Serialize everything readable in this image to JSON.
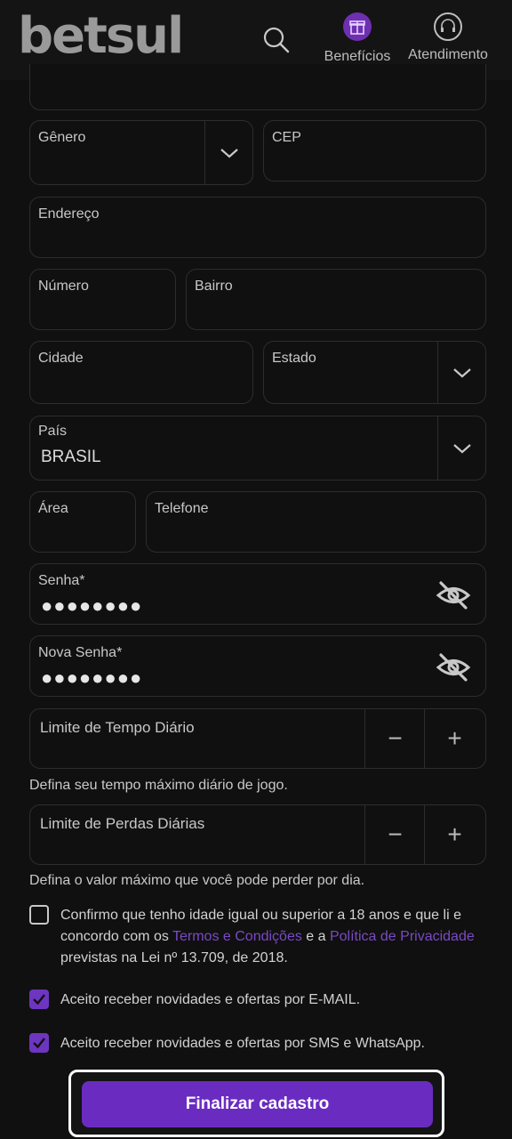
{
  "header": {
    "logo": "betsul",
    "beneficios": "Benefícios",
    "atendimento": "Atendimento"
  },
  "form": {
    "genero": {
      "label": "Gênero",
      "value": ""
    },
    "cep": {
      "label": "CEP",
      "value": ""
    },
    "endereco": {
      "label": "Endereço",
      "value": ""
    },
    "numero": {
      "label": "Número",
      "value": ""
    },
    "bairro": {
      "label": "Bairro",
      "value": ""
    },
    "cidade": {
      "label": "Cidade",
      "value": ""
    },
    "estado": {
      "label": "Estado",
      "value": ""
    },
    "pais": {
      "label": "País",
      "value": "BRASIL"
    },
    "area": {
      "label": "Área",
      "value": ""
    },
    "telefone": {
      "label": "Telefone",
      "value": ""
    },
    "senha": {
      "label": "Senha*",
      "value": "●●●●●●●●"
    },
    "nova_senha": {
      "label": "Nova Senha*",
      "value": "●●●●●●●●"
    },
    "limite_tempo": {
      "label": "Limite de Tempo Diário",
      "hint": "Defina seu tempo máximo diário de jogo.",
      "minus": "−",
      "plus": "+"
    },
    "limite_perdas": {
      "label": "Limite de Perdas Diárias",
      "hint": "Defina o valor máximo que você pode perder por dia.",
      "minus": "−",
      "plus": "+"
    }
  },
  "consent": {
    "age": {
      "checked": false,
      "text_1": "Confirmo que tenho idade igual ou superior a 18 anos e que li e concordo com os ",
      "link_terms": "Termos e Condições",
      "text_2": " e a ",
      "link_privacy": "Política de Privacidade",
      "text_3": " previstas na Lei nº 13.709, de 2018."
    },
    "email": {
      "checked": true,
      "text": "Aceito receber novidades e ofertas por E-MAIL."
    },
    "sms": {
      "checked": true,
      "text": "Aceito receber novidades e ofertas por SMS e WhatsApp."
    }
  },
  "submit_label": "Finalizar cadastro",
  "colors": {
    "accent": "#6a2cc0",
    "link": "#7a4ac4",
    "background": "#101010"
  }
}
